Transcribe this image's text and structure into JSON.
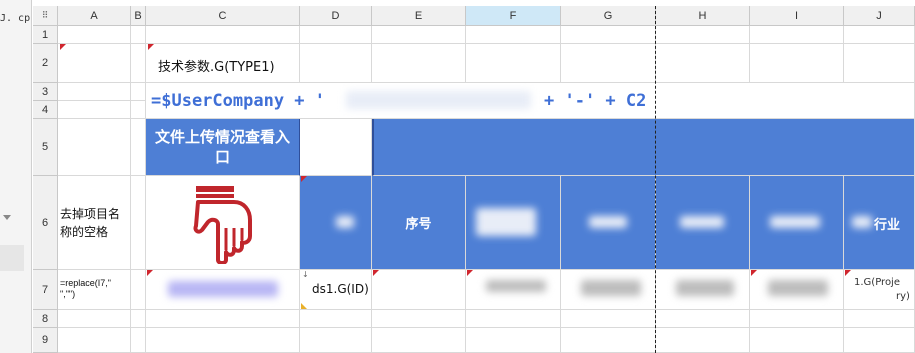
{
  "sidebar": {
    "fragment": "J. cp"
  },
  "grid": {
    "corner_label": "⠿",
    "columns": [
      "A",
      "B",
      "C",
      "D",
      "E",
      "F",
      "G",
      "H",
      "I",
      "J"
    ],
    "rows": [
      "1",
      "2",
      "3",
      "4",
      "5",
      "6",
      "7",
      "8",
      "9"
    ],
    "selected_column": "F"
  },
  "cells": {
    "C2": "技术参数.G(TYPE1)",
    "C3_prefix": "=$UserCompany + '",
    "C3_suffix": "+ '-' + C2",
    "C5": "文件上传情况查看入口",
    "A6": "去掉项目名称的空格",
    "E6": "序号",
    "J6_fragment": "行业",
    "A7": "=replace(I7,\" \",\"\")",
    "D7": "ds1.G(ID)",
    "J7_fragment": "1.G(Proje",
    "J7_fragment2": "ry)"
  },
  "icons": {
    "hand": "pointing-hand-down-icon"
  },
  "colors": {
    "header_blue": "#4e7fd5",
    "formula_blue": "#3f6fd6",
    "hand_red": "#c0262c",
    "column_selected": "#cfe8f7"
  }
}
